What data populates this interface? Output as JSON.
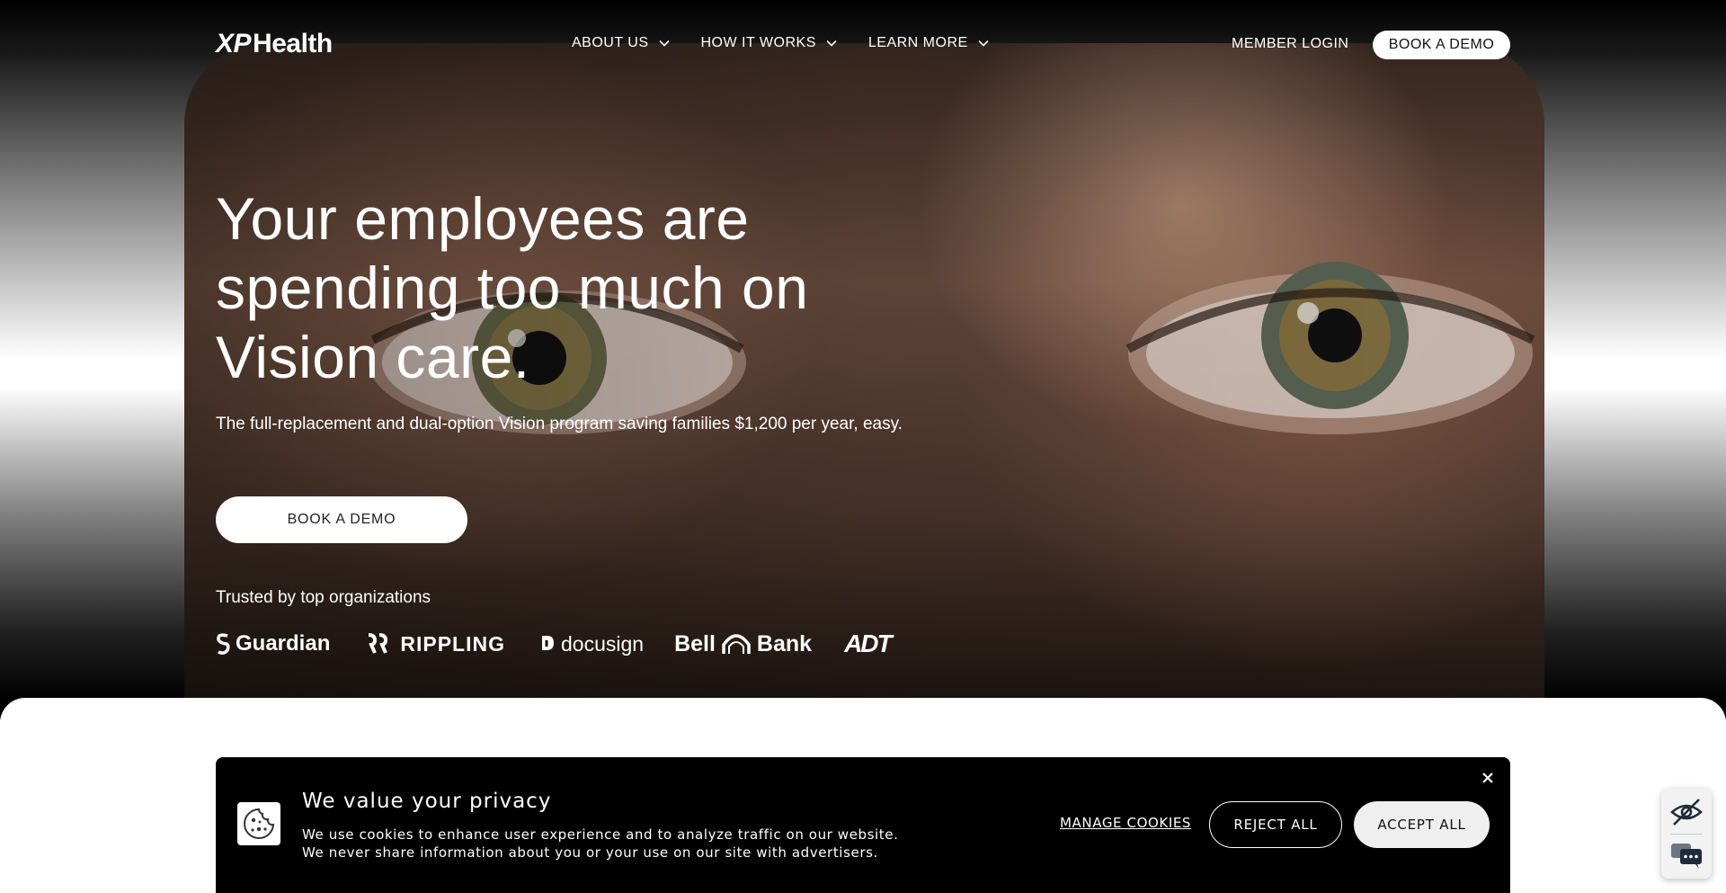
{
  "nav": {
    "logo_xp": "XP",
    "logo_health": "Health",
    "items": [
      {
        "label": "ABOUT US"
      },
      {
        "label": "HOW IT WORKS"
      },
      {
        "label": "LEARN MORE"
      }
    ],
    "member_login": "MEMBER LOGIN",
    "book_demo": "BOOK A DEMO"
  },
  "hero": {
    "headline": "Your employees are spending too much on Vision care.",
    "subline": "The full-replacement and dual-option Vision program saving families $1,200 per year, easy.",
    "cta": "BOOK A DEMO",
    "trusted": "Trusted by top organizations",
    "logos": [
      "Guardian",
      "RIPPLING",
      "docusign",
      "Bell",
      "Bank",
      "ADT"
    ]
  },
  "cookie": {
    "title": "We value your privacy",
    "line1": "We use cookies to enhance user experience and to analyze traffic on our website.",
    "line2": "We never share information about you or your use on our site with advertisers.",
    "manage": "MANAGE COOKIES",
    "reject": "REJECT ALL",
    "accept": "ACCEPT ALL"
  },
  "colors": {
    "accent": "#ffffff",
    "banner_bg": "#000000",
    "accept_bg": "#efefef"
  },
  "icons": [
    "chevron-down-icon",
    "cookie-icon",
    "close-icon",
    "eye-off-icon",
    "chat-icon"
  ]
}
